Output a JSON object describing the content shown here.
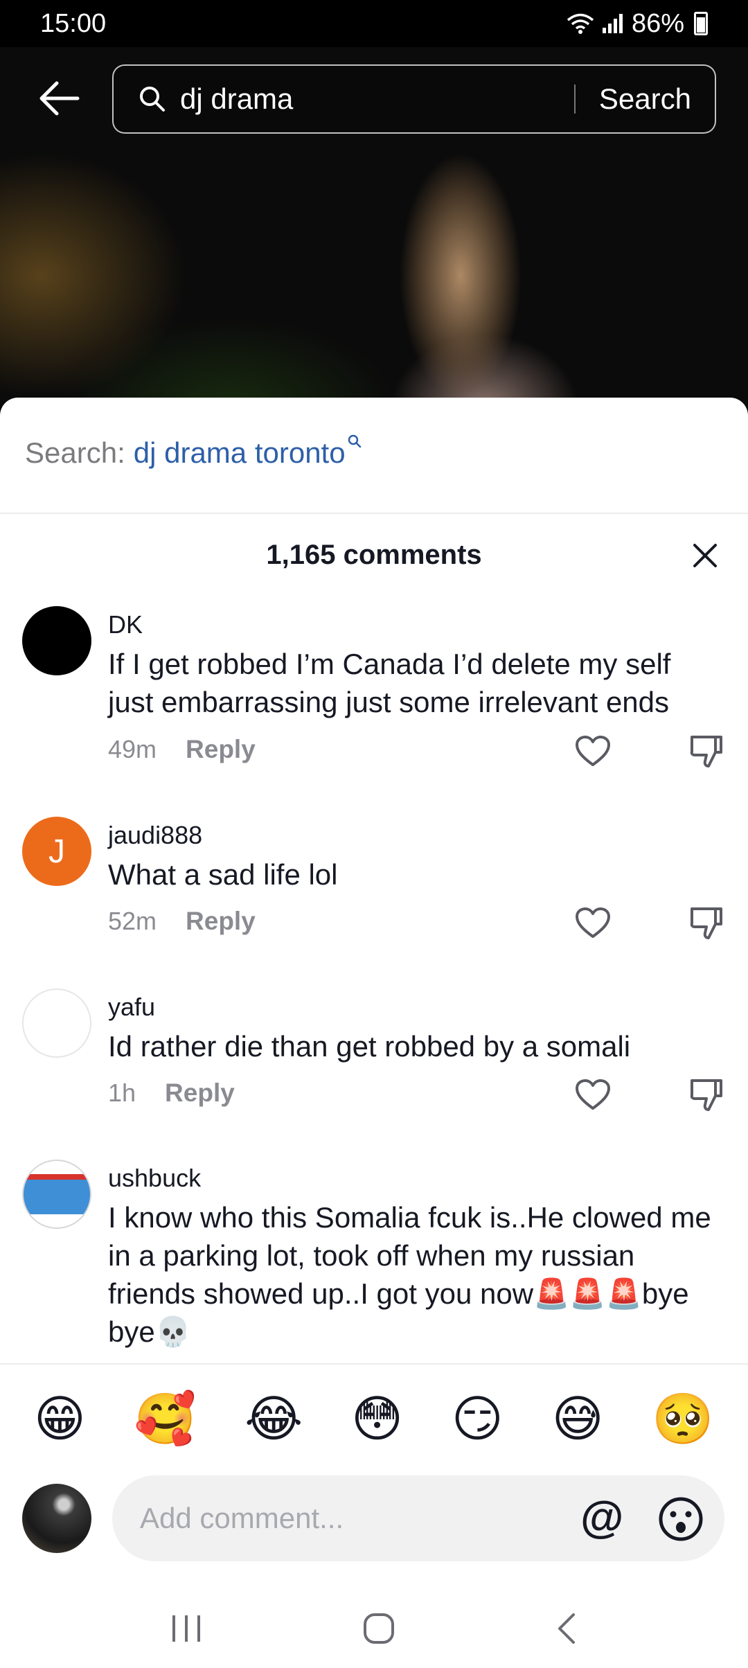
{
  "status_bar": {
    "time": "15:00",
    "battery": "86%"
  },
  "search": {
    "query": "dj drama",
    "submit_label": "Search"
  },
  "suggestion": {
    "prefix": "Search:",
    "term": "dj drama toronto"
  },
  "comments_header": {
    "count_label": "1,165 comments"
  },
  "comments": [
    {
      "username": "DK",
      "text": "If I get robbed I’m Canada I’d delete my self just embarrassing just some irrelevant ends",
      "time": "49m",
      "reply_label": "Reply",
      "avatar_color": "#000000",
      "avatar_letter": ""
    },
    {
      "username": "jaudi888",
      "text": "What a sad life lol",
      "time": "52m",
      "reply_label": "Reply",
      "avatar_color": "#ec6b1b",
      "avatar_letter": "J"
    },
    {
      "username": "yafu",
      "text": "Id rather die than get robbed by a somali",
      "time": "1h",
      "reply_label": "Reply",
      "avatar_color": "#ffffff",
      "avatar_letter": ""
    },
    {
      "username": "ushbuck",
      "text": "I know who this Somalia fcuk is..He clowed me in a parking lot, took off when my russian friends showed up..I got you now🚨🚨🚨bye bye💀",
      "time": "",
      "reply_label": "",
      "avatar_color": "#6aa7d8",
      "avatar_letter": ""
    }
  ],
  "emoji_bar": [
    "😁",
    "🥰",
    "😂",
    "😳",
    "😏",
    "😅",
    "🥺"
  ],
  "comment_input": {
    "placeholder": "Add comment...",
    "mention_symbol": "@"
  }
}
